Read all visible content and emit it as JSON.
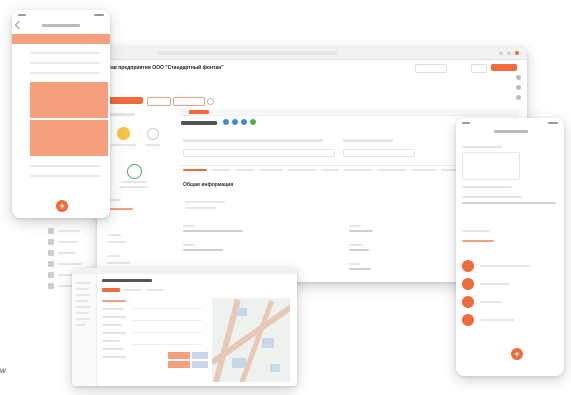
{
  "desktop": {
    "page_title": "Устав предприятия ООО \"Стандартный фонтан\"",
    "tabs": [
      "",
      "",
      ""
    ],
    "subheading": "Общая информация",
    "orange_button": "",
    "colors": {
      "accent": "#f06b3b",
      "bar": "#e6e6e6"
    }
  },
  "phone_left": {
    "fab_icon": "plus-icon"
  },
  "phone_right": {
    "fab_icon": "plus-icon"
  },
  "side_mark": "w",
  "colors": {
    "accent": "#f06b3b",
    "accent_light": "#f4a07e",
    "map_road": "#e8c9b8",
    "map_block": "#c9d8e8"
  }
}
